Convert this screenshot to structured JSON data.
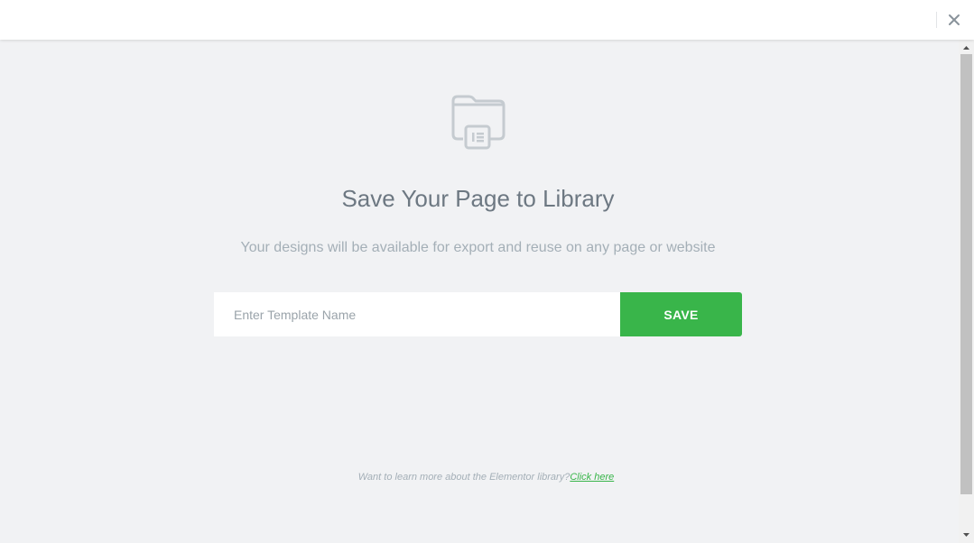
{
  "header": {
    "close_icon": "close-icon"
  },
  "main": {
    "icon": "folder-library-icon",
    "title": "Save Your Page to Library",
    "subtitle": "Your designs will be available for export and reuse on any page or website",
    "input": {
      "placeholder": "Enter Template Name",
      "value": ""
    },
    "save_label": "SAVE"
  },
  "footer": {
    "note": "Want to learn more about the Elementor library?",
    "link_label": "Click here"
  },
  "colors": {
    "accent": "#39b54a",
    "background": "#f1f2f4",
    "title": "#6d7882",
    "muted": "#a4afb7"
  }
}
